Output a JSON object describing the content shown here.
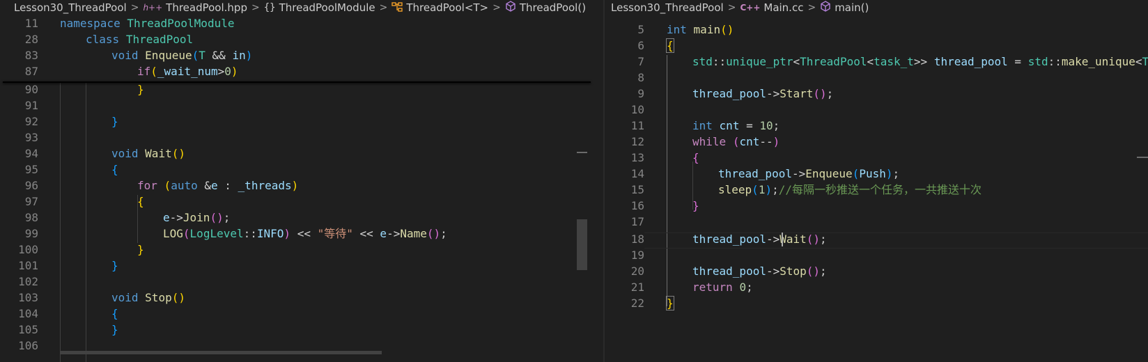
{
  "left_editor": {
    "breadcrumb": {
      "folder": "Lesson30_ThreadPool",
      "file": "ThreadPool.hpp",
      "file_icon": "h++",
      "namespace_icon": "{}",
      "namespace": "ThreadPoolModule",
      "class": "ThreadPool<T>",
      "method": "ThreadPool()"
    },
    "sticky_lines": [
      {
        "ln": "11",
        "text": "namespace ThreadPoolModule"
      },
      {
        "ln": "28",
        "text": "class ThreadPool"
      },
      {
        "ln": "83",
        "text": "void Enqueue(T && in)"
      },
      {
        "ln": "87",
        "text": "if(_wait_num>0)"
      }
    ],
    "lines": [
      {
        "ln": "90",
        "text": "}"
      },
      {
        "ln": "91",
        "text": ""
      },
      {
        "ln": "92",
        "text": "}"
      },
      {
        "ln": "93",
        "text": ""
      },
      {
        "ln": "94",
        "text": "void Wait()"
      },
      {
        "ln": "95",
        "text": "{"
      },
      {
        "ln": "96",
        "text": "for (auto &e : _threads)"
      },
      {
        "ln": "97",
        "text": "{"
      },
      {
        "ln": "98",
        "text": "e->Join();"
      },
      {
        "ln": "99",
        "text": "LOG(LogLevel::INFO) << \"等待\" << e->Name();"
      },
      {
        "ln": "100",
        "text": "}"
      },
      {
        "ln": "101",
        "text": "}"
      },
      {
        "ln": "102",
        "text": ""
      },
      {
        "ln": "103",
        "text": "void Stop()"
      },
      {
        "ln": "104",
        "text": "{"
      },
      {
        "ln": "105",
        "text": "}"
      },
      {
        "ln": "106",
        "text": ""
      }
    ]
  },
  "right_editor": {
    "breadcrumb": {
      "folder": "Lesson30_ThreadPool",
      "file": "Main.cc",
      "file_icon": "C++",
      "method": "main()"
    },
    "lines": [
      {
        "ln": "5",
        "text": "int main()"
      },
      {
        "ln": "6",
        "text": "{"
      },
      {
        "ln": "7",
        "text": "std::unique_ptr<ThreadPool<task_t>> thread_pool = std::make_unique<T"
      },
      {
        "ln": "8",
        "text": ""
      },
      {
        "ln": "9",
        "text": "thread_pool->Start();"
      },
      {
        "ln": "10",
        "text": ""
      },
      {
        "ln": "11",
        "text": "int cnt = 10;"
      },
      {
        "ln": "12",
        "text": "while (cnt--)"
      },
      {
        "ln": "13",
        "text": "{"
      },
      {
        "ln": "14",
        "text": "thread_pool->Enqueue(Push);"
      },
      {
        "ln": "15",
        "text": "sleep(1);//每隔一秒推送一个任务，一共推送十次"
      },
      {
        "ln": "16",
        "text": "}"
      },
      {
        "ln": "17",
        "text": ""
      },
      {
        "ln": "18",
        "text": "thread_pool->Wait();"
      },
      {
        "ln": "19",
        "text": ""
      },
      {
        "ln": "20",
        "text": "thread_pool->Stop();"
      },
      {
        "ln": "21",
        "text": "return 0;"
      },
      {
        "ln": "22",
        "text": "}"
      }
    ]
  },
  "theme": {
    "background": "#1f1f1f",
    "keyword": "#569cd6",
    "control": "#c586c0",
    "function": "#dcdcaa",
    "type": "#4ec9b0",
    "variable": "#9cdcfe",
    "number": "#b5cea8",
    "string": "#ce9178",
    "comment": "#6a9955"
  }
}
